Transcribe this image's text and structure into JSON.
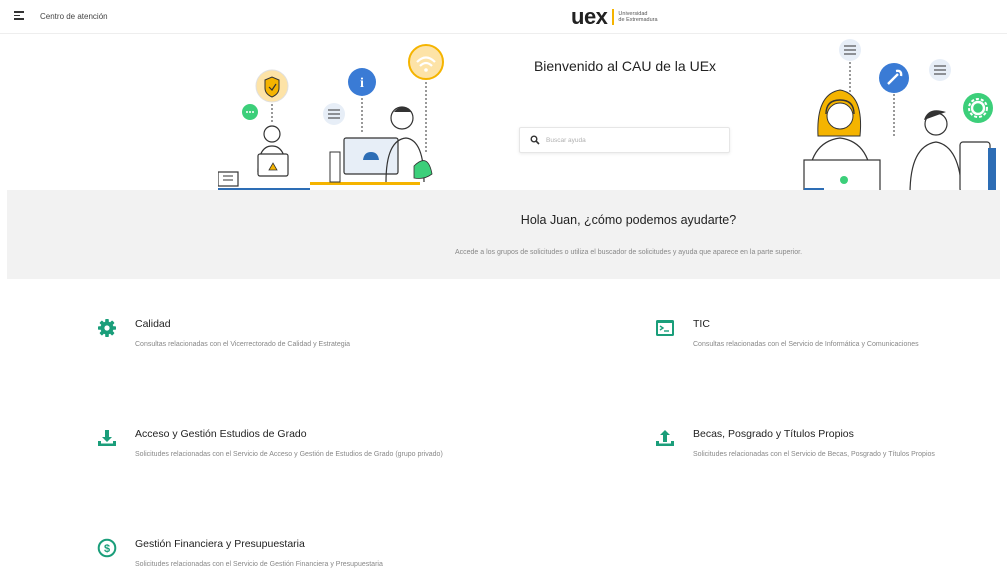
{
  "header": {
    "menu_label": "Centro de atención",
    "logo": {
      "brand": "uex",
      "line1": "Universidad",
      "line2": "de Extremadura"
    }
  },
  "hero": {
    "title": "Bienvenido al CAU de la UEx",
    "search_placeholder": "Buscar ayuda"
  },
  "greeting": {
    "title": "Hola Juan, ¿cómo podemos ayudarte?",
    "subtitle": "Accede a los grupos de solicitudes o utiliza el buscador de solicitudes y ayuda que aparece en la parte superior."
  },
  "categories": [
    {
      "title": "Calidad",
      "description": "Consultas relacionadas con el Vicerrectorado de Calidad y Estrategia",
      "icon": "gear-icon"
    },
    {
      "title": "TIC",
      "description": "Consultas relacionadas con el Servicio de Informática y Comunicaciones",
      "icon": "terminal-icon"
    },
    {
      "title": "Acceso y Gestión Estudios de Grado",
      "description": "Solicitudes relacionadas con el Servicio de Acceso y Gestión de Estudios de Grado (grupo privado)",
      "icon": "download-icon"
    },
    {
      "title": "Becas, Posgrado y Títulos Propios",
      "description": "Solicitudes relacionadas con el Servicio de Becas, Posgrado y Títulos Propios",
      "icon": "upload-icon"
    },
    {
      "title": "Gestión Financiera y Presupuestaria",
      "description": "Solicitudes relacionadas con el Servicio de Gestión Financiera y Presupuestaria",
      "icon": "dollar-icon"
    }
  ],
  "colors": {
    "accent": "#1a9e7a",
    "logo_bar": "#f5b400",
    "greeting_bg": "#f2f2f2"
  }
}
